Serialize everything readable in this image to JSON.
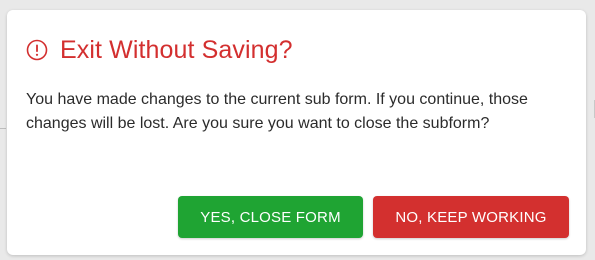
{
  "dialog": {
    "title": "Exit Without Saving?",
    "icon": "alert-circle-icon",
    "message": "You have made changes to the current sub form. If you continue, those changes will be lost. Are you sure you want to close the subform?",
    "confirm_label": "YES, CLOSE FORM",
    "cancel_label": "NO, KEEP WORKING"
  },
  "colors": {
    "title": "#d32f2f",
    "confirm": "#1fa433",
    "cancel": "#d3302f"
  }
}
